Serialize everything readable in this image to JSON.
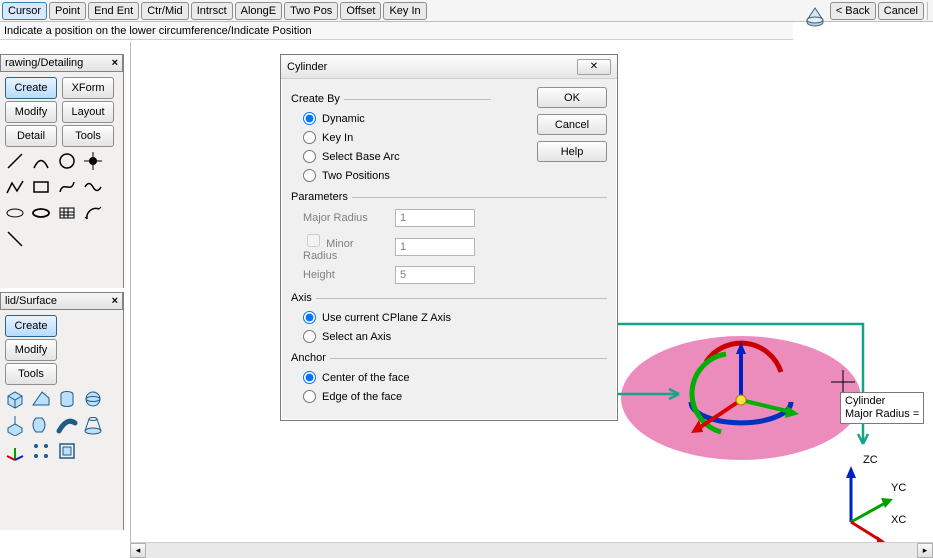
{
  "snap": {
    "buttons": [
      "Cursor",
      "Point",
      "End Ent",
      "Ctr/Mid",
      "Intrsct",
      "AlongE",
      "Two Pos",
      "Offset",
      "Key In"
    ],
    "active": "Cursor",
    "back": "< Back",
    "cancel": "Cancel"
  },
  "status": "Indicate a position on the lower circumference/Indicate Position",
  "panel_drawing": {
    "title": "rawing/Detailing",
    "rows": [
      [
        "Create",
        "XForm"
      ],
      [
        "Modify",
        "Layout"
      ],
      [
        "Detail",
        "Tools"
      ]
    ]
  },
  "panel_solid": {
    "title": "lid/Surface",
    "buttons": [
      "Create",
      "Modify",
      "Tools"
    ]
  },
  "dialog": {
    "title": "Cylinder",
    "ok": "OK",
    "cancel": "Cancel",
    "help": "Help",
    "group_create": "Create By",
    "opts_create": [
      "Dynamic",
      "Key In",
      "Select Base Arc",
      "Two Positions"
    ],
    "group_params": "Parameters",
    "param_major": "Major Radius",
    "param_major_val": "1",
    "param_minor": "Minor Radius",
    "param_minor_val": "1",
    "param_height": "Height",
    "param_height_val": "5",
    "group_axis": "Axis",
    "opts_axis": [
      "Use current CPlane Z Axis",
      "Select an Axis"
    ],
    "group_anchor": "Anchor",
    "opts_anchor": [
      "Center of the face",
      "Edge of the face"
    ]
  },
  "tooltip": {
    "l1": "Cylinder",
    "l2": "Major Radius ="
  },
  "axes": {
    "z": "ZC",
    "y": "YC",
    "x": "XC"
  }
}
